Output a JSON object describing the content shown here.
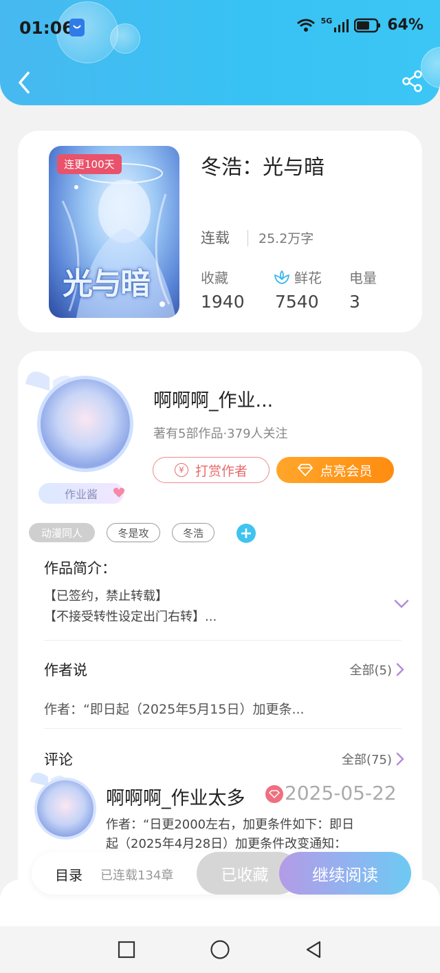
{
  "status_bar": {
    "time": "01:06",
    "network": "5G",
    "battery": "64%"
  },
  "header": {
    "back_icon": "chevron-left-icon",
    "share_icon": "share-icon"
  },
  "book": {
    "cover_badge": "连更100天",
    "cover_title_art": "光与暗",
    "title": "冬浩：光与暗",
    "status": "连载",
    "word_count": "25.2万字",
    "stats": [
      {
        "label": "收藏",
        "value": "1940"
      },
      {
        "label": "鲜花",
        "value": "7540",
        "icon": "flower-icon"
      },
      {
        "label": "电量",
        "value": "3"
      }
    ]
  },
  "author": {
    "name": "啊啊啊_作业...",
    "meta": "著有5部作品·379人关注",
    "avatar_tag": "作业酱",
    "tip_button": "打赏作者",
    "vip_button": "点亮会员"
  },
  "tags": [
    "动漫同人",
    "冬是攻",
    "冬浩"
  ],
  "intro": {
    "title": "作品简介：",
    "lines": [
      "【已签约，禁止转载】",
      "【不接受转性设定出门右转】..."
    ]
  },
  "author_says": {
    "title": "作者说",
    "all_label": "全部(5)",
    "preview": "作者：“即日起（2025年5月15日）加更条..."
  },
  "comments": {
    "title": "评论",
    "all_label": "全部(75)",
    "first": {
      "user": "啊啊啊_作业太多",
      "date": "2025-05-22",
      "lines": [
        "作者：“日更2000左右，加更条件如下：即日",
        "起（2025年4月28日）加更条件改变通知："
      ]
    }
  },
  "bottom_bar": {
    "toc_label": "目录",
    "chapters": "已连载134章",
    "favorited_button": "已收藏",
    "continue_button": "继续阅读"
  },
  "colors": {
    "header_blue": "#3cc2f3",
    "accent_orange": "#ff9a1f",
    "tip_red": "#e86a6a"
  }
}
